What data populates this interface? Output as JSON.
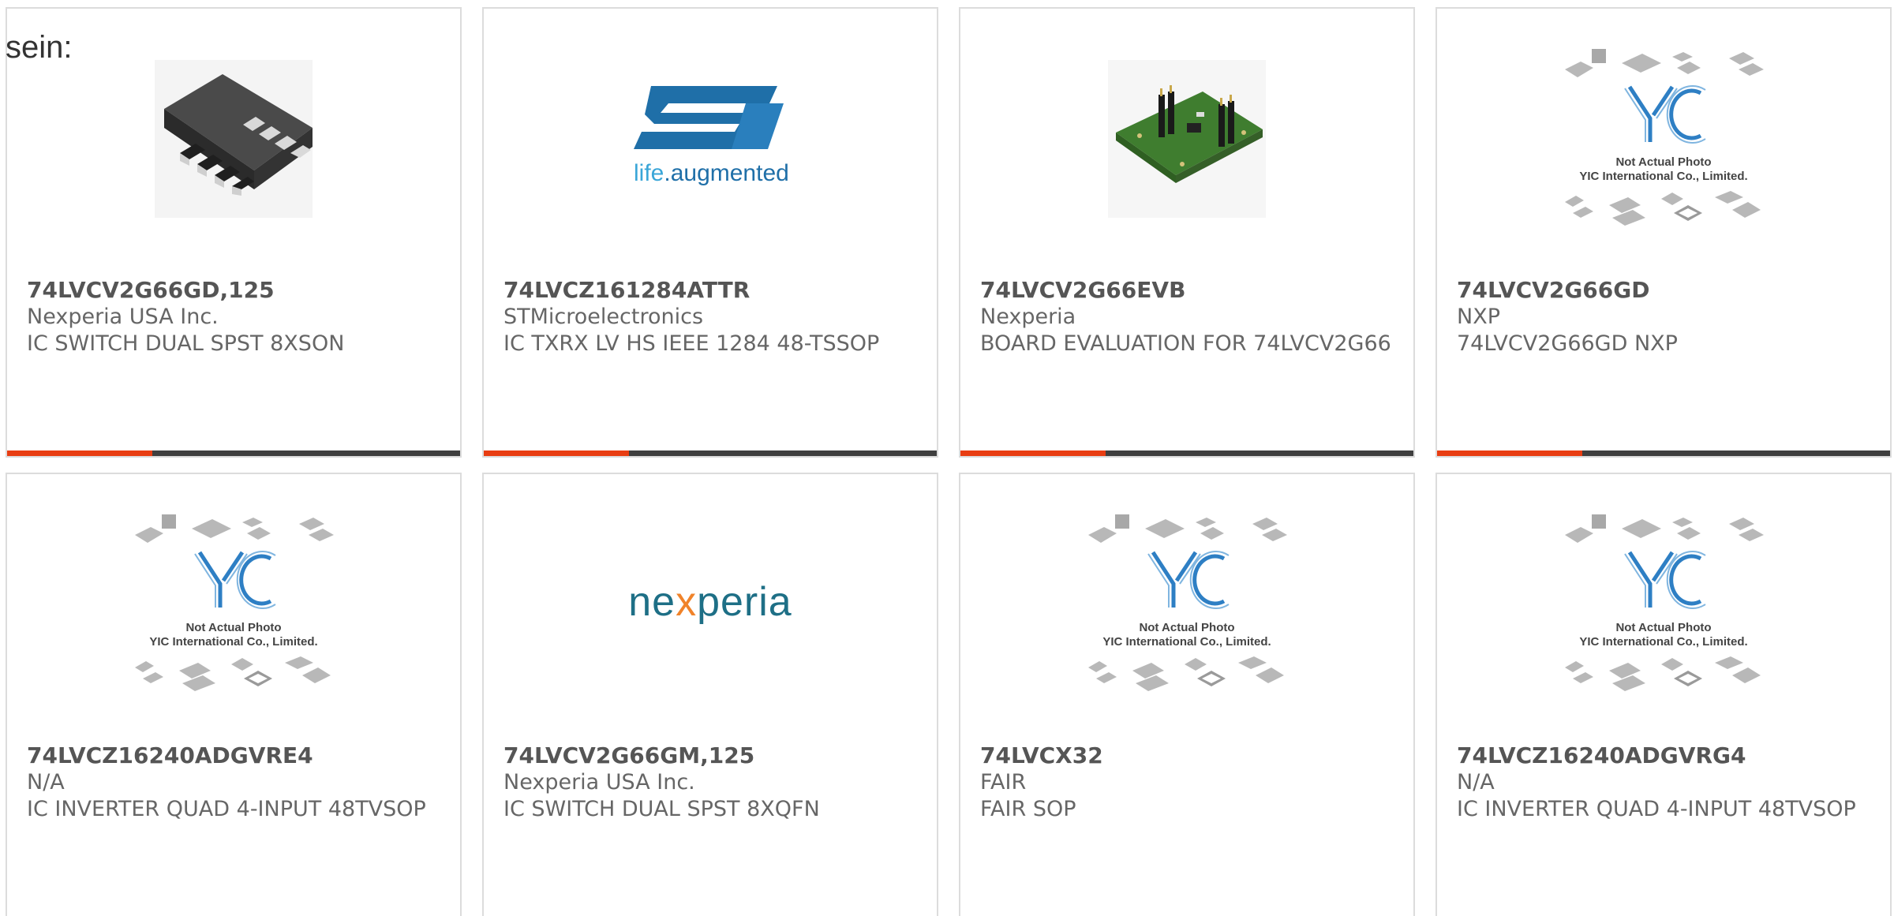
{
  "lead_text": "sein:",
  "colors": {
    "accent": "#e83d12",
    "bar": "#3f3f3f",
    "card_border": "#dcdcdc",
    "st_blue": "#1f6fa8",
    "st_light_blue": "#3aa6d8",
    "nexperia_teal": "#1e6f86",
    "nexperia_orange": "#f0832a",
    "yic_blue": "#2e7fc4",
    "pcb_green": "#3f7d2f"
  },
  "products": [
    {
      "part_number": "74LVCV2G66GD,125",
      "manufacturer": "Nexperia USA Inc.",
      "description": "IC SWITCH DUAL SPST 8XSON",
      "image": "xson8-chip-icon"
    },
    {
      "part_number": "74LVCZ161284ATTR",
      "manufacturer": "STMicroelectronics",
      "description": "IC TXRX LV HS IEEE 1284 48-TSSOP",
      "image": "st-logo-icon",
      "logo_tagline_prefix": "life",
      "logo_tagline_dot": ".",
      "logo_tagline_suffix": "augmented"
    },
    {
      "part_number": "74LVCV2G66EVB",
      "manufacturer": "Nexperia",
      "description": "BOARD EVALUATION FOR 74LVCV2G66",
      "image": "eval-board-icon"
    },
    {
      "part_number": "74LVCV2G66GD",
      "manufacturer": "NXP",
      "description": "74LVCV2G66GD NXP",
      "image": "yic-placeholder-icon",
      "placeholder_line1": "Not Actual Photo",
      "placeholder_line2": "YIC International Co., Limited."
    },
    {
      "part_number": "74LVCZ16240ADGVRE4",
      "manufacturer": "N/A",
      "description": "IC INVERTER QUAD 4-INPUT 48TVSOP",
      "image": "yic-placeholder-icon",
      "placeholder_line1": "Not Actual Photo",
      "placeholder_line2": "YIC International Co., Limited."
    },
    {
      "part_number": "74LVCV2G66GM,125",
      "manufacturer": "Nexperia USA Inc.",
      "description": "IC SWITCH DUAL SPST 8XQFN",
      "image": "nexperia-logo-icon",
      "logo_part1": "ne",
      "logo_part2": "x",
      "logo_part3": "peria"
    },
    {
      "part_number": "74LVCX32",
      "manufacturer": "FAIR",
      "description": "FAIR SOP",
      "image": "yic-placeholder-icon",
      "placeholder_line1": "Not Actual Photo",
      "placeholder_line2": "YIC International Co., Limited."
    },
    {
      "part_number": "74LVCZ16240ADGVRG4",
      "manufacturer": "N/A",
      "description": "IC INVERTER QUAD 4-INPUT 48TVSOP",
      "image": "yic-placeholder-icon",
      "placeholder_line1": "Not Actual Photo",
      "placeholder_line2": "YIC International Co., Limited."
    }
  ]
}
